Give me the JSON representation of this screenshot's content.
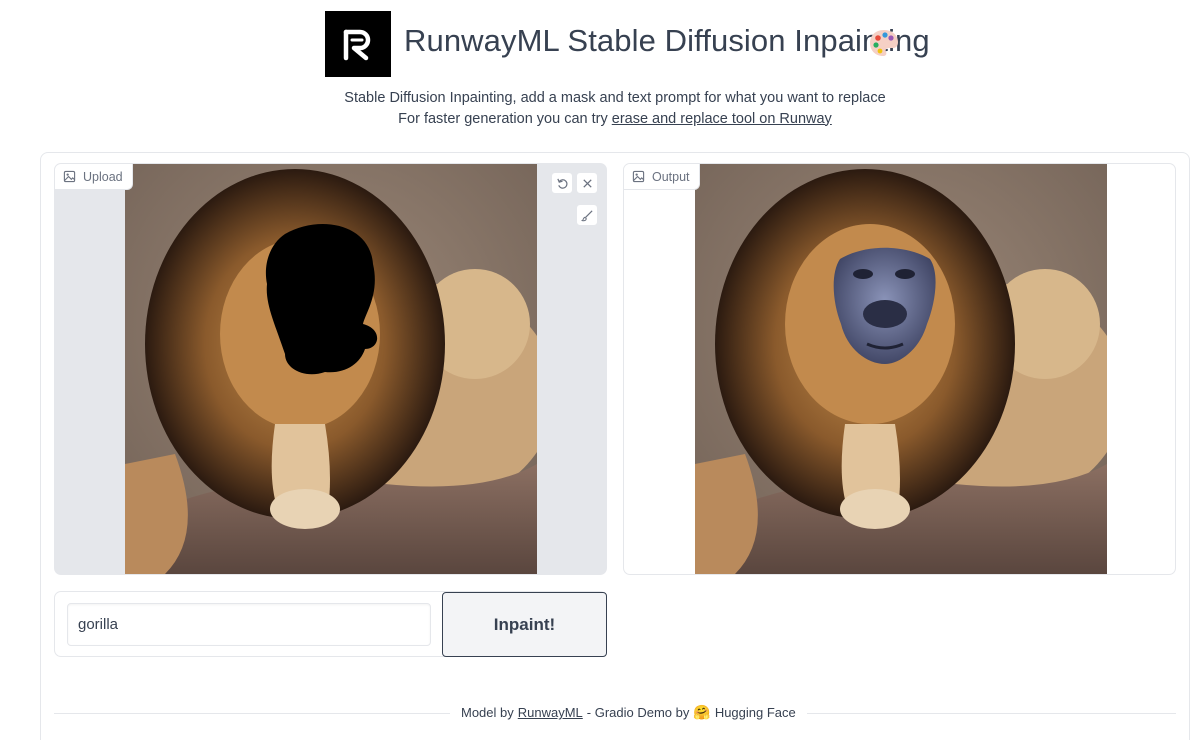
{
  "header": {
    "title": "RunwayML Stable Diffusion Inpainting",
    "logo_icon": "runway-r-logo",
    "title_icon": "artist-palette-icon"
  },
  "subtitle": {
    "line1": "Stable Diffusion Inpainting, add a mask and text prompt for what you want to replace",
    "line2_prefix": "For faster generation you can try ",
    "line2_link": "erase and replace tool on Runway"
  },
  "upload_panel": {
    "label": "Upload",
    "tools": [
      "undo-icon",
      "clear-icon",
      "brush-icon"
    ]
  },
  "output_panel": {
    "label": "Output"
  },
  "prompt": {
    "value": "gorilla",
    "button_label": "Inpaint!"
  },
  "footer": {
    "prefix": "Model by ",
    "model_link": "RunwayML",
    "middle": " - Gradio Demo by ",
    "hf_icon": "hugging-face-emoji-icon",
    "hf_label": "Hugging Face"
  },
  "colors": {
    "text": "#374151",
    "border": "#e5e7eb",
    "upload_bg": "#e5e7eb",
    "logo_bg": "#000000"
  }
}
